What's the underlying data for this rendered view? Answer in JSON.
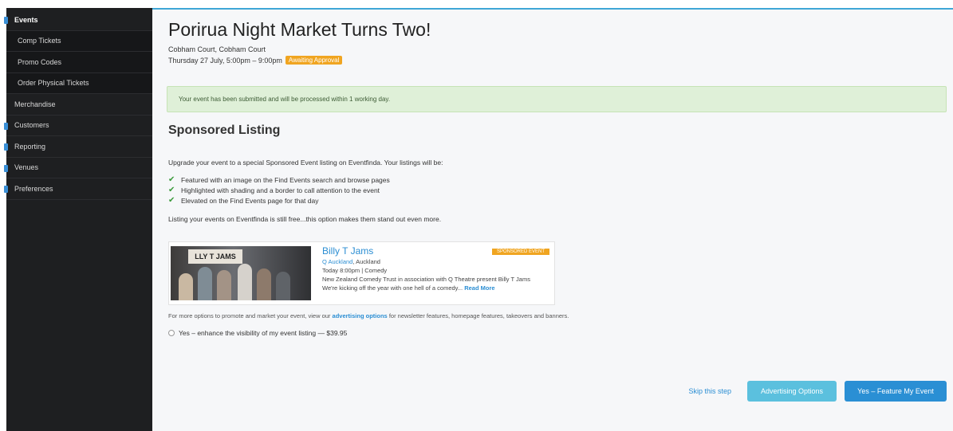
{
  "sidebar": {
    "items": [
      {
        "label": "Events",
        "active": true,
        "sub": false
      },
      {
        "label": "Comp Tickets",
        "active": false,
        "sub": true
      },
      {
        "label": "Promo Codes",
        "active": false,
        "sub": true
      },
      {
        "label": "Order Physical Tickets",
        "active": false,
        "sub": true
      },
      {
        "label": "Merchandise",
        "active": false,
        "sub": false
      },
      {
        "label": "Customers",
        "active": false,
        "sub": false
      },
      {
        "label": "Reporting",
        "active": false,
        "sub": false
      },
      {
        "label": "Venues",
        "active": false,
        "sub": false
      },
      {
        "label": "Preferences",
        "active": false,
        "sub": false
      }
    ]
  },
  "event": {
    "title": "Porirua Night Market Turns Two!",
    "venue": "Cobham Court, Cobham Court",
    "datetime": "Thursday 27 July, 5:00pm – 9:00pm",
    "status_badge": "Awaiting Approval"
  },
  "alert": {
    "message": "Your event has been submitted and will be processed within 1 working day."
  },
  "sponsored": {
    "section_title": "Sponsored Listing",
    "intro": "Upgrade your event to a special Sponsored Event listing on Eventfinda. Your listings will be:",
    "benefits": [
      "Featured with an image on the Find Events search and browse pages",
      "Highlighted with shading and a border to call attention to the event",
      "Elevated on the Find Events page for that day"
    ],
    "free_note": "Listing your events on Eventfinda is still free...this option makes them stand out even more."
  },
  "example_card": {
    "image_text": "LLY T JAMS",
    "title": "Billy T Jams",
    "venue_link": "Q Auckland",
    "venue_city": ", Auckland",
    "time_line": "Today 8:00pm | Comedy",
    "desc_line1": "New Zealand Comedy Trust in association with Q Theatre present Billy T Jams",
    "desc_line2": "We're kicking off the year with one hell of a comedy...",
    "read_more": "Read More",
    "badge": "SPONSORED EVENT"
  },
  "options": {
    "prefix": "For more options to promote and market your event, view our",
    "link": "advertising options",
    "suffix": "for newsletter features, homepage features, takeovers and banners."
  },
  "upgrade_option": {
    "label": "Yes – enhance the visibility of my event listing — $39.95"
  },
  "actions": {
    "skip": "Skip this step",
    "advertising": "Advertising Options",
    "feature": "Yes – Feature My Event"
  },
  "colors": {
    "sidebar_bg": "#1e1f21",
    "accent_blue": "#2a8fd4",
    "light_blue": "#5bc0de",
    "badge_orange": "#f0a521",
    "alert_green": "#dff0d8"
  }
}
